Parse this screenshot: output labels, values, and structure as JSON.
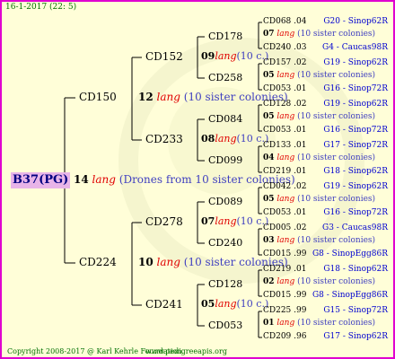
{
  "header": "16-1-2017 (22: 5)",
  "root": {
    "name": "B37(PG)",
    "count": "14",
    "lang": "lang",
    "note": "(Drones from 10 sister colonies)"
  },
  "level1": [
    {
      "name": "CD150",
      "count": "12",
      "lang": "lang",
      "note": "(10 sister colonies)"
    },
    {
      "name": "CD224",
      "count": "10",
      "lang": "lang",
      "note": "(10 sister colonies)"
    }
  ],
  "level2": [
    {
      "name": "CD152",
      "count": "09",
      "lang": "lang",
      "note": "(10 c.)"
    },
    {
      "name": "CD233",
      "count": "08",
      "lang": "lang",
      "note": "(10 c.)"
    },
    {
      "name": "CD278",
      "count": "07",
      "lang": "lang",
      "note": "(10 c.)"
    },
    {
      "name": "CD241",
      "count": "05",
      "lang": "lang",
      "note": "(10 c.)"
    }
  ],
  "level3": [
    {
      "name": "CD178",
      "count": "07",
      "lang": "lang",
      "note": "(10 sister colonies)"
    },
    {
      "name": "CD258",
      "count": "05",
      "lang": "lang",
      "note": "(10 sister colonies)"
    },
    {
      "name": "CD084",
      "count": "05",
      "lang": "lang",
      "note": "(10 sister colonies)"
    },
    {
      "name": "CD099",
      "count": "04",
      "lang": "lang",
      "note": "(10 sister colonies)"
    },
    {
      "name": "CD089",
      "count": "05",
      "lang": "lang",
      "note": "(10 sister colonies)"
    },
    {
      "name": "CD240",
      "count": "03",
      "lang": "lang",
      "note": "(10 sister colonies)"
    },
    {
      "name": "CD128",
      "count": "02",
      "lang": "lang",
      "note": "(10 sister colonies)"
    },
    {
      "name": "CD053",
      "count": "01",
      "lang": "lang",
      "note": "(10 sister colonies)"
    }
  ],
  "level4": [
    {
      "name": "CD068",
      "val": ".04",
      "tag": "G20 - Sinop62R"
    },
    {
      "name": "CD240",
      "val": ".03",
      "tag": "G4 - Caucas98R"
    },
    {
      "name": "CD157",
      "val": ".02",
      "tag": "G19 - Sinop62R"
    },
    {
      "name": "CD053",
      "val": ".01",
      "tag": "G16 - Sinop72R"
    },
    {
      "name": "CD128",
      "val": ".02",
      "tag": "G19 - Sinop62R"
    },
    {
      "name": "CD053",
      "val": ".01",
      "tag": "G16 - Sinop72R"
    },
    {
      "name": "CD133",
      "val": ".01",
      "tag": "G17 - Sinop72R"
    },
    {
      "name": "CD219",
      "val": ".01",
      "tag": "G18 - Sinop62R"
    },
    {
      "name": "CD042",
      "val": ".02",
      "tag": "G19 - Sinop62R"
    },
    {
      "name": "CD053",
      "val": ".01",
      "tag": "G16 - Sinop72R"
    },
    {
      "name": "CD005",
      "val": ".02",
      "tag": "G3 - Caucas98R"
    },
    {
      "name": "CD015",
      "val": ".99",
      "tag": "G8 - SinopEgg86R"
    },
    {
      "name": "CD219",
      "val": ".01",
      "tag": "G18 - Sinop62R"
    },
    {
      "name": "CD015",
      "val": ".99",
      "tag": "G8 - SinopEgg86R"
    },
    {
      "name": "CD225",
      "val": ".99",
      "tag": "G15 - Sinop72R"
    },
    {
      "name": "CD209",
      "val": ".96",
      "tag": "G17 - Sinop62R"
    }
  ],
  "footer": {
    "copyright": "Copyright 2008-2017 @ Karl Kehrle Foundation.",
    "website": "www.pedigreeapis.org"
  }
}
